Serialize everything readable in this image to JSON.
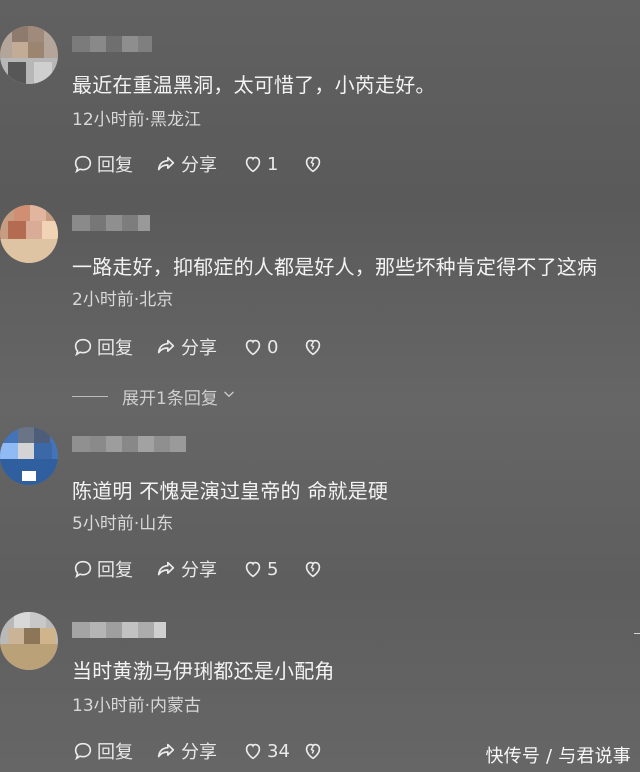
{
  "comments": [
    {
      "text": "最近在重温黑洞，太可惜了，小芮走好。",
      "meta": "12小时前·黑龙江",
      "actions": {
        "reply": "回复",
        "share": "分享",
        "likes": "1"
      }
    },
    {
      "text": "一路走好，抑郁症的人都是好人，那些坏种肯定得不了这病",
      "meta": "2小时前·北京",
      "actions": {
        "reply": "回复",
        "share": "分享",
        "likes": "0"
      }
    },
    {
      "text": "陈道明 不愧是演过皇帝的 命就是硬",
      "meta": "5小时前·山东",
      "actions": {
        "reply": "回复",
        "share": "分享",
        "likes": "5"
      }
    },
    {
      "text": "当时黄渤马伊琍都还是小配角",
      "meta": "13小时前·内蒙古",
      "actions": {
        "reply": "回复",
        "share": "分享",
        "likes": "34"
      }
    }
  ],
  "expand": {
    "label": "展开1条回复"
  },
  "watermark": "快传号 / 与君说事"
}
